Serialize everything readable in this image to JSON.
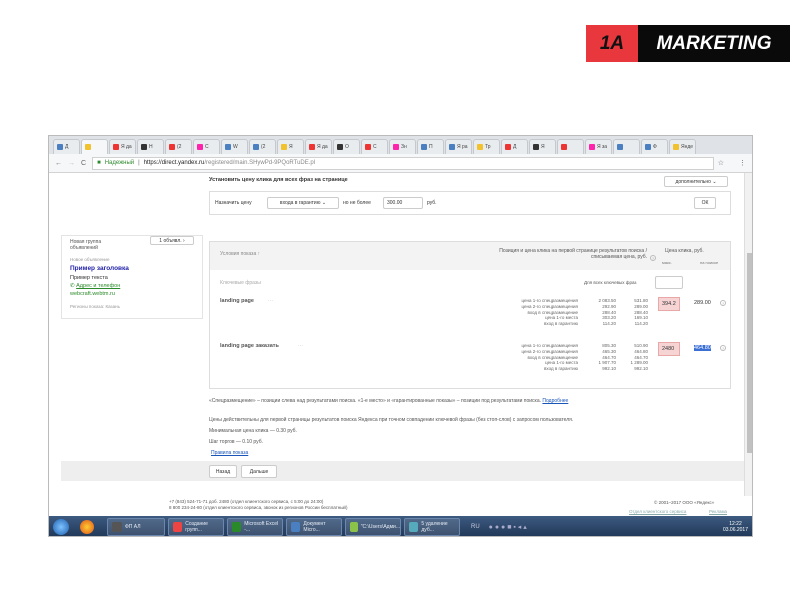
{
  "logo": {
    "part1": "1A",
    "part2": "MARKETING"
  },
  "browser": {
    "tabs": [
      "Д",
      "",
      "Я да",
      "Н",
      "(2",
      "С",
      "W",
      "(2",
      "Я",
      "Я да",
      "О",
      "С",
      "Зн",
      "П",
      "Я ра",
      "Тр",
      "Д",
      "Я",
      "",
      "Я за",
      "",
      "Ф",
      "Янде"
    ],
    "secure": "Надежный",
    "url_domain": "https://direct.yandex.ru",
    "url_path": "/registered/main.SHywPd-9PQoRTuDE.pl"
  },
  "set_price": {
    "title": "Установить цену клика для всех фраз на странице",
    "more": "дополнительно",
    "assign": "Назначить цену",
    "mode": "входа в гарантию",
    "not_more": "но не более",
    "value": "300.00",
    "currency": "руб.",
    "ok": "ОК"
  },
  "ad": {
    "group": "Новая группа объявлений",
    "count": "1 объявл.",
    "new_ad": "Новое объявление",
    "headline": "Пример заголовка",
    "text": "Пример текста",
    "contact": "Адрес и телефон",
    "site": "webcraft.webtm.ru",
    "regions": "Регионы показа: Казань"
  },
  "table": {
    "conditions": "Условия показа",
    "position_header": "Позиция и цена клика на первой странице результатов поиска / списываемая цена, руб.",
    "price_header": "Цена клика, руб.",
    "max": "макс.",
    "on_search": "на поиске",
    "keywords": "Ключевые фразы",
    "for_all": "Для всех ключевых фраз",
    "rows": [
      {
        "phrase": "landing page",
        "labels": [
          "цена 1-го спецразмещения",
          "цена 2-го спецразмещения",
          "вход в спецразмещение",
          "цена 1-го места",
          "вход в гарантию"
        ],
        "col1": [
          "2 083.50",
          "292.90",
          "288.40",
          "303.20",
          "114.20"
        ],
        "col2": [
          "531.80",
          "289.00",
          "288.40",
          "169.10",
          "114.20"
        ],
        "max": "394.2",
        "search": "289.00"
      },
      {
        "phrase": "landing page заказать",
        "labels": [
          "цена 1-го спецразмещения",
          "цена 2-го спецразмещения",
          "вход в спецразмещение",
          "цена 1-го места",
          "вход в гарантию"
        ],
        "col1": [
          "805.30",
          "465.30",
          "464.70",
          "1 907.70",
          "992.10"
        ],
        "col2": [
          "510.90",
          "464.80",
          "464.70",
          "1 289.00",
          "992.10"
        ],
        "max": "2480",
        "search": "464.80"
      }
    ]
  },
  "notes": {
    "special": "«Спецразмещение» – позиции слева над результатами поиска. «1-е место» и «гарантированные показы» – позиции под результатами поиска.",
    "more": "Подробнее",
    "valid": "Цены действительны для первой страницы результатов поиска Яндекса при точном совпадении ключевой фразы (без стоп-слов) с запросом пользователя.",
    "min": "Минимальная цена клика — 0.30 руб.",
    "step": "Шаг торгов — 0.10 руб.",
    "rules": "Правила показа"
  },
  "nav": {
    "back": "Назад",
    "next": "Дальше"
  },
  "footer": {
    "phone1": "+7 (843) 524-71-71 доб. 2480 (отдел клиентского сервиса, с 5:00 до 24:00)",
    "phone2": "8 800 234-24-80 (отдел клиентского сервиса, звонок из регионов России бесплатный)",
    "copyright": "© 2001–2017  ООО «Яндекс»",
    "support": "Отдел клиентского сервиса",
    "ads": "Реклама"
  },
  "taskbar": {
    "items": [
      "ФП АЛ",
      "Создание групп...",
      "Microsoft Excel -...",
      "Документ Micro...",
      "\"C:\\Users\\Адми...",
      "5 удаление дуб..."
    ],
    "lang": "RU",
    "time": "12:22",
    "date": "03.06.2017"
  }
}
